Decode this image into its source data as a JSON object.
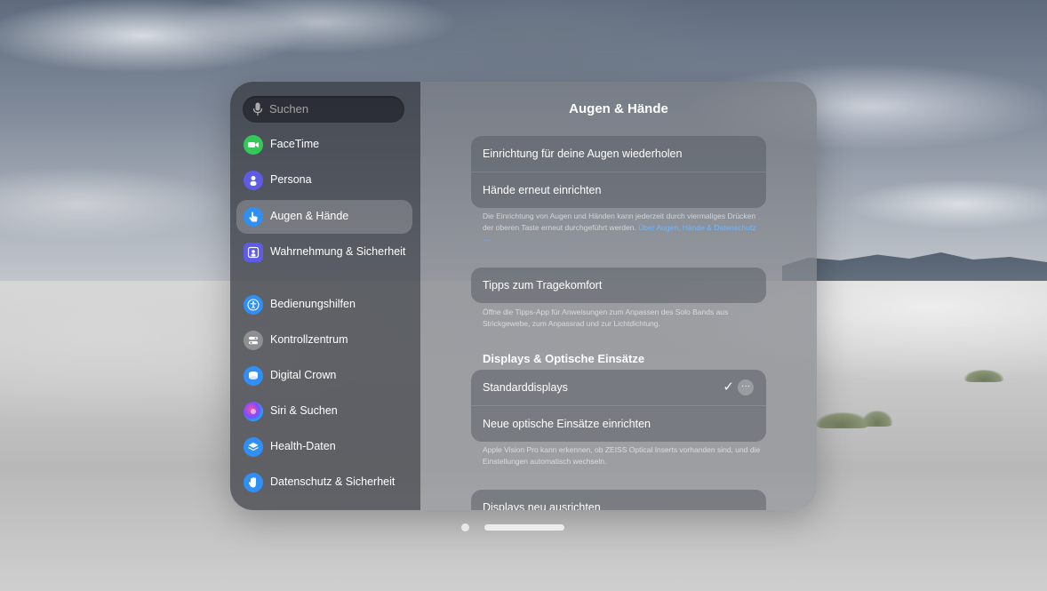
{
  "search": {
    "placeholder": "Suchen"
  },
  "sidebar": {
    "items": [
      {
        "label": "FaceTime",
        "icon": "facetime-icon",
        "color": "#34c759"
      },
      {
        "label": "Persona",
        "icon": "persona-icon",
        "color": "#5e5ce6"
      },
      {
        "label": "Augen & Hände",
        "icon": "hand-pointer-icon",
        "color": "#2f8ff5",
        "selected": true
      },
      {
        "label": "Wahrnehmung & Sicherheit",
        "icon": "awareness-icon",
        "color": "#5e5ce6"
      },
      {
        "label": "Bedienungshilfen",
        "icon": "accessibility-icon",
        "color": "#2f8ff5"
      },
      {
        "label": "Kontrollzentrum",
        "icon": "control-center-icon",
        "color": "#8e8e93"
      },
      {
        "label": "Digital Crown",
        "icon": "digital-crown-icon",
        "color": "#2f8ff5"
      },
      {
        "label": "Siri & Suchen",
        "icon": "siri-icon",
        "color": "#2b2b3a"
      },
      {
        "label": "Health-Daten",
        "icon": "health-data-icon",
        "color": "#2f8ff5"
      },
      {
        "label": "Datenschutz & Sicherheit",
        "icon": "privacy-hand-icon",
        "color": "#2f8ff5"
      }
    ]
  },
  "main": {
    "title": "Augen & Hände",
    "group1": {
      "rows": [
        "Einrichtung für deine Augen wiederholen",
        "Hände erneut einrichten"
      ],
      "footer_text": "Die Einrichtung von Augen und Händen kann jederzeit durch viermaliges Drücken der oberen Taste erneut durchgeführt werden.",
      "footer_link": "Über Augen, Hände & Datenschutz …"
    },
    "group2": {
      "rows": [
        "Tipps zum Tragekomfort"
      ],
      "footer_text": "Öffne die Tipps-App für Anweisungen zum Anpassen des Solo Bands aus Strickgewebe, zum Anpassrad und zur Lichtdichtung."
    },
    "section3": {
      "header": "Displays & Optische Einsätze",
      "rows": [
        "Standarddisplays",
        "Neue optische Einsätze einrichten"
      ],
      "check": "✓",
      "more": "···",
      "footer_text": "Apple Vision Pro kann erkennen, ob ZEISS Optical Inserts vorhanden sind, und die Einstellungen automatisch wechseln."
    },
    "group4": {
      "rows": [
        "Displays neu ausrichten"
      ]
    }
  }
}
